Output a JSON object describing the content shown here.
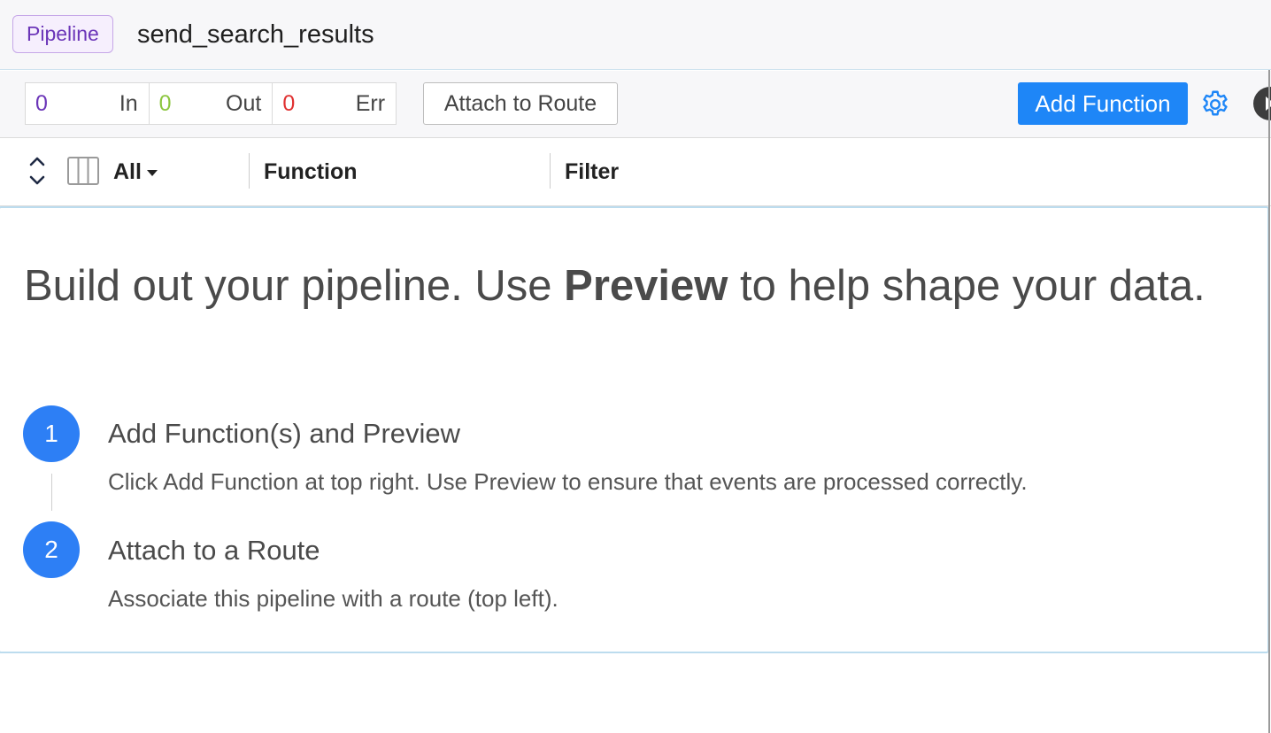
{
  "header": {
    "type_badge": "Pipeline",
    "pipeline_name": "send_search_results"
  },
  "toolbar": {
    "counters": [
      {
        "value": "0",
        "label": "In",
        "color": "#6b35b8"
      },
      {
        "value": "0",
        "label": "Out",
        "color": "#8cc63f"
      },
      {
        "value": "0",
        "label": "Err",
        "color": "#e03131"
      }
    ],
    "attach_label": "Attach to Route",
    "add_function_label": "Add Function",
    "accent_color": "#1e86f7"
  },
  "columns": {
    "filter_selected": "All",
    "function_header": "Function",
    "filter_header": "Filter"
  },
  "empty_state": {
    "title_prefix": "Build out your pipeline. Use ",
    "title_bold": "Preview",
    "title_suffix": " to help shape your data.",
    "steps": [
      {
        "number": "1",
        "title": "Add Function(s) and Preview",
        "description": "Click Add Function at top right. Use Preview to ensure that events are processed correctly."
      },
      {
        "number": "2",
        "title": "Attach to a Route",
        "description": "Associate this pipeline with a route (top left)."
      }
    ]
  }
}
